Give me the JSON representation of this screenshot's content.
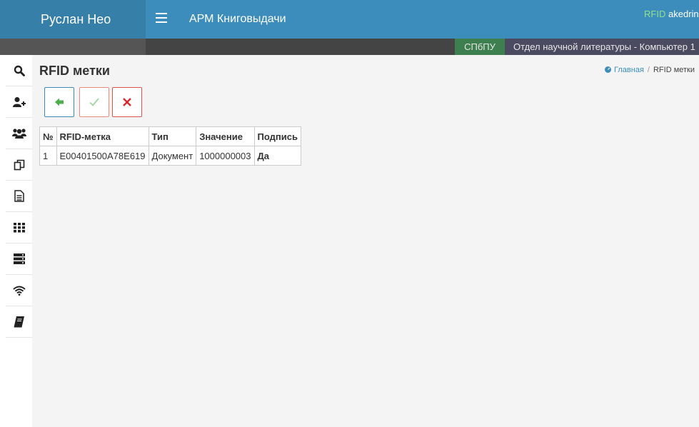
{
  "header": {
    "brand": "Руслан Нео",
    "app_title": "АРМ Книговыдачи",
    "rfid": "RFID",
    "user": "akedrin"
  },
  "subbar": {
    "org": "СПбПУ",
    "department": "Отдел научной литературы - Компьютер 1"
  },
  "sidebar": {
    "items": [
      {
        "icon": "search-icon"
      },
      {
        "icon": "add-user-icon"
      },
      {
        "icon": "users-icon"
      },
      {
        "icon": "copy-icon"
      },
      {
        "icon": "document-icon"
      },
      {
        "icon": "grid-icon"
      },
      {
        "icon": "server-icon"
      },
      {
        "icon": "wifi-icon"
      },
      {
        "icon": "book-icon"
      }
    ]
  },
  "page": {
    "title": "RFID метки",
    "breadcrumb": {
      "home": "Главная",
      "current": "RFID метки"
    }
  },
  "toolbar": {
    "back_icon": "arrow-left-icon",
    "ok_icon": "checkmark-icon",
    "cancel_icon": "close-icon"
  },
  "table": {
    "columns": [
      "№",
      "RFID-метка",
      "Тип",
      "Значение",
      "Подпись"
    ],
    "rows": [
      {
        "num": "1",
        "tag": "E00401500A78E619",
        "type": "Документ",
        "value": "1000000003",
        "signature": "Да"
      }
    ]
  },
  "colors": {
    "header": "#3c8dbc",
    "brand": "#367fa9",
    "accent_green": "#1f9a1f",
    "danger": "#d9534f"
  }
}
